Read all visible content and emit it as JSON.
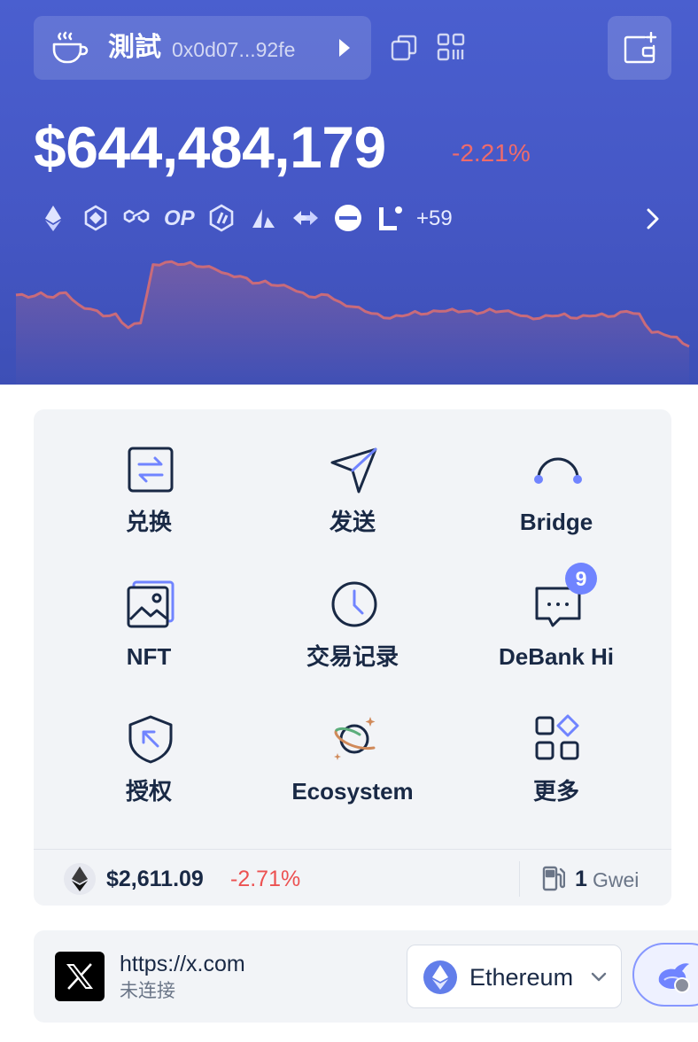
{
  "header": {
    "account_name": "測試",
    "account_address": "0x0d07...92fe",
    "balance": "$644,484,179",
    "balance_change": "-2.21%",
    "chains": [
      "ethereum-icon",
      "bnb-chain-icon",
      "polygon-icon",
      "OP",
      "arbitrum-icon",
      "avalanche-icon",
      "zksync-icon",
      "base-icon",
      "linea-icon"
    ],
    "chains_op_label": "OP",
    "chains_more": "+59"
  },
  "balance_curve": {
    "type": "area",
    "values": [
      100,
      99,
      101,
      99,
      101,
      96,
      94,
      91,
      92,
      86,
      88,
      113,
      114,
      113,
      114,
      112,
      111,
      109,
      108,
      105,
      106,
      104,
      103,
      101,
      99,
      100,
      97,
      95,
      93,
      92,
      90,
      91,
      93,
      92,
      93,
      94,
      93,
      92,
      94,
      93,
      92,
      91,
      90,
      91,
      92,
      90,
      91,
      92,
      91,
      93,
      92,
      84,
      83,
      82,
      78
    ],
    "color": "#c96b7a"
  },
  "actions": [
    {
      "id": "swap",
      "label": "兑换",
      "icon": "swap-icon"
    },
    {
      "id": "send",
      "label": "发送",
      "icon": "send-icon"
    },
    {
      "id": "bridge",
      "label": "Bridge",
      "icon": "bridge-icon"
    },
    {
      "id": "nft",
      "label": "NFT",
      "icon": "nft-icon"
    },
    {
      "id": "history",
      "label": "交易记录",
      "icon": "clock-icon"
    },
    {
      "id": "debank",
      "label": "DeBank Hi",
      "icon": "chat-icon",
      "badge": "9"
    },
    {
      "id": "approval",
      "label": "授权",
      "icon": "shield-icon"
    },
    {
      "id": "ecosystem",
      "label": "Ecosystem",
      "icon": "planet-icon"
    },
    {
      "id": "more",
      "label": "更多",
      "icon": "grid-icon"
    }
  ],
  "price_row": {
    "eth_price": "$2,611.09",
    "eth_change": "-2.71%",
    "gas_value": "1",
    "gas_unit": "Gwei"
  },
  "site": {
    "url": "https://x.com",
    "status": "未连接",
    "network": "Ethereum"
  },
  "colors": {
    "header_bg": "#4a5fcf",
    "negative": "#ec5151",
    "accent": "#7084ff",
    "text": "#192945"
  }
}
